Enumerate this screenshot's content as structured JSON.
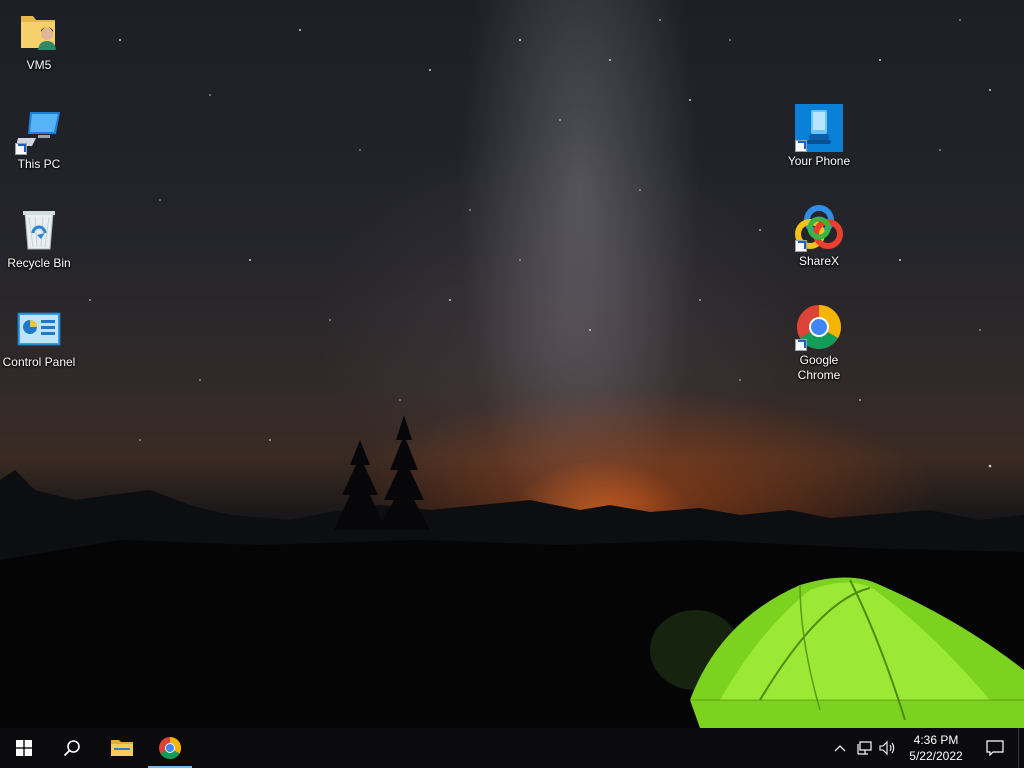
{
  "desktop": {
    "left_icons": [
      {
        "label": "VM5",
        "icon": "user-folder-icon"
      },
      {
        "label": "This PC",
        "icon": "computer-icon"
      },
      {
        "label": "Recycle Bin",
        "icon": "recycle-bin-icon"
      },
      {
        "label": "Control Panel",
        "icon": "control-panel-icon"
      }
    ],
    "right_icons": [
      {
        "label": "Your Phone",
        "icon": "your-phone-icon"
      },
      {
        "label": "ShareX",
        "icon": "sharex-icon"
      },
      {
        "label": "Google Chrome",
        "icon": "chrome-icon"
      }
    ]
  },
  "taskbar": {
    "start": {
      "icon": "windows-logo-icon"
    },
    "search": {
      "icon": "search-icon"
    },
    "pinned": [
      {
        "name": "File Explorer",
        "icon": "file-explorer-icon"
      },
      {
        "name": "Google Chrome",
        "icon": "chrome-icon",
        "active": true
      }
    ],
    "tray": {
      "icons": [
        "chevron-up-icon",
        "network-icon",
        "volume-icon"
      ],
      "time": "4:36 PM",
      "date": "5/22/2022",
      "notification_icon": "notification-icon"
    }
  },
  "colors": {
    "taskbar_bg": "#0b0b0d",
    "active_indicator": "#76b9ed",
    "tent_green": "#8ee32a"
  }
}
